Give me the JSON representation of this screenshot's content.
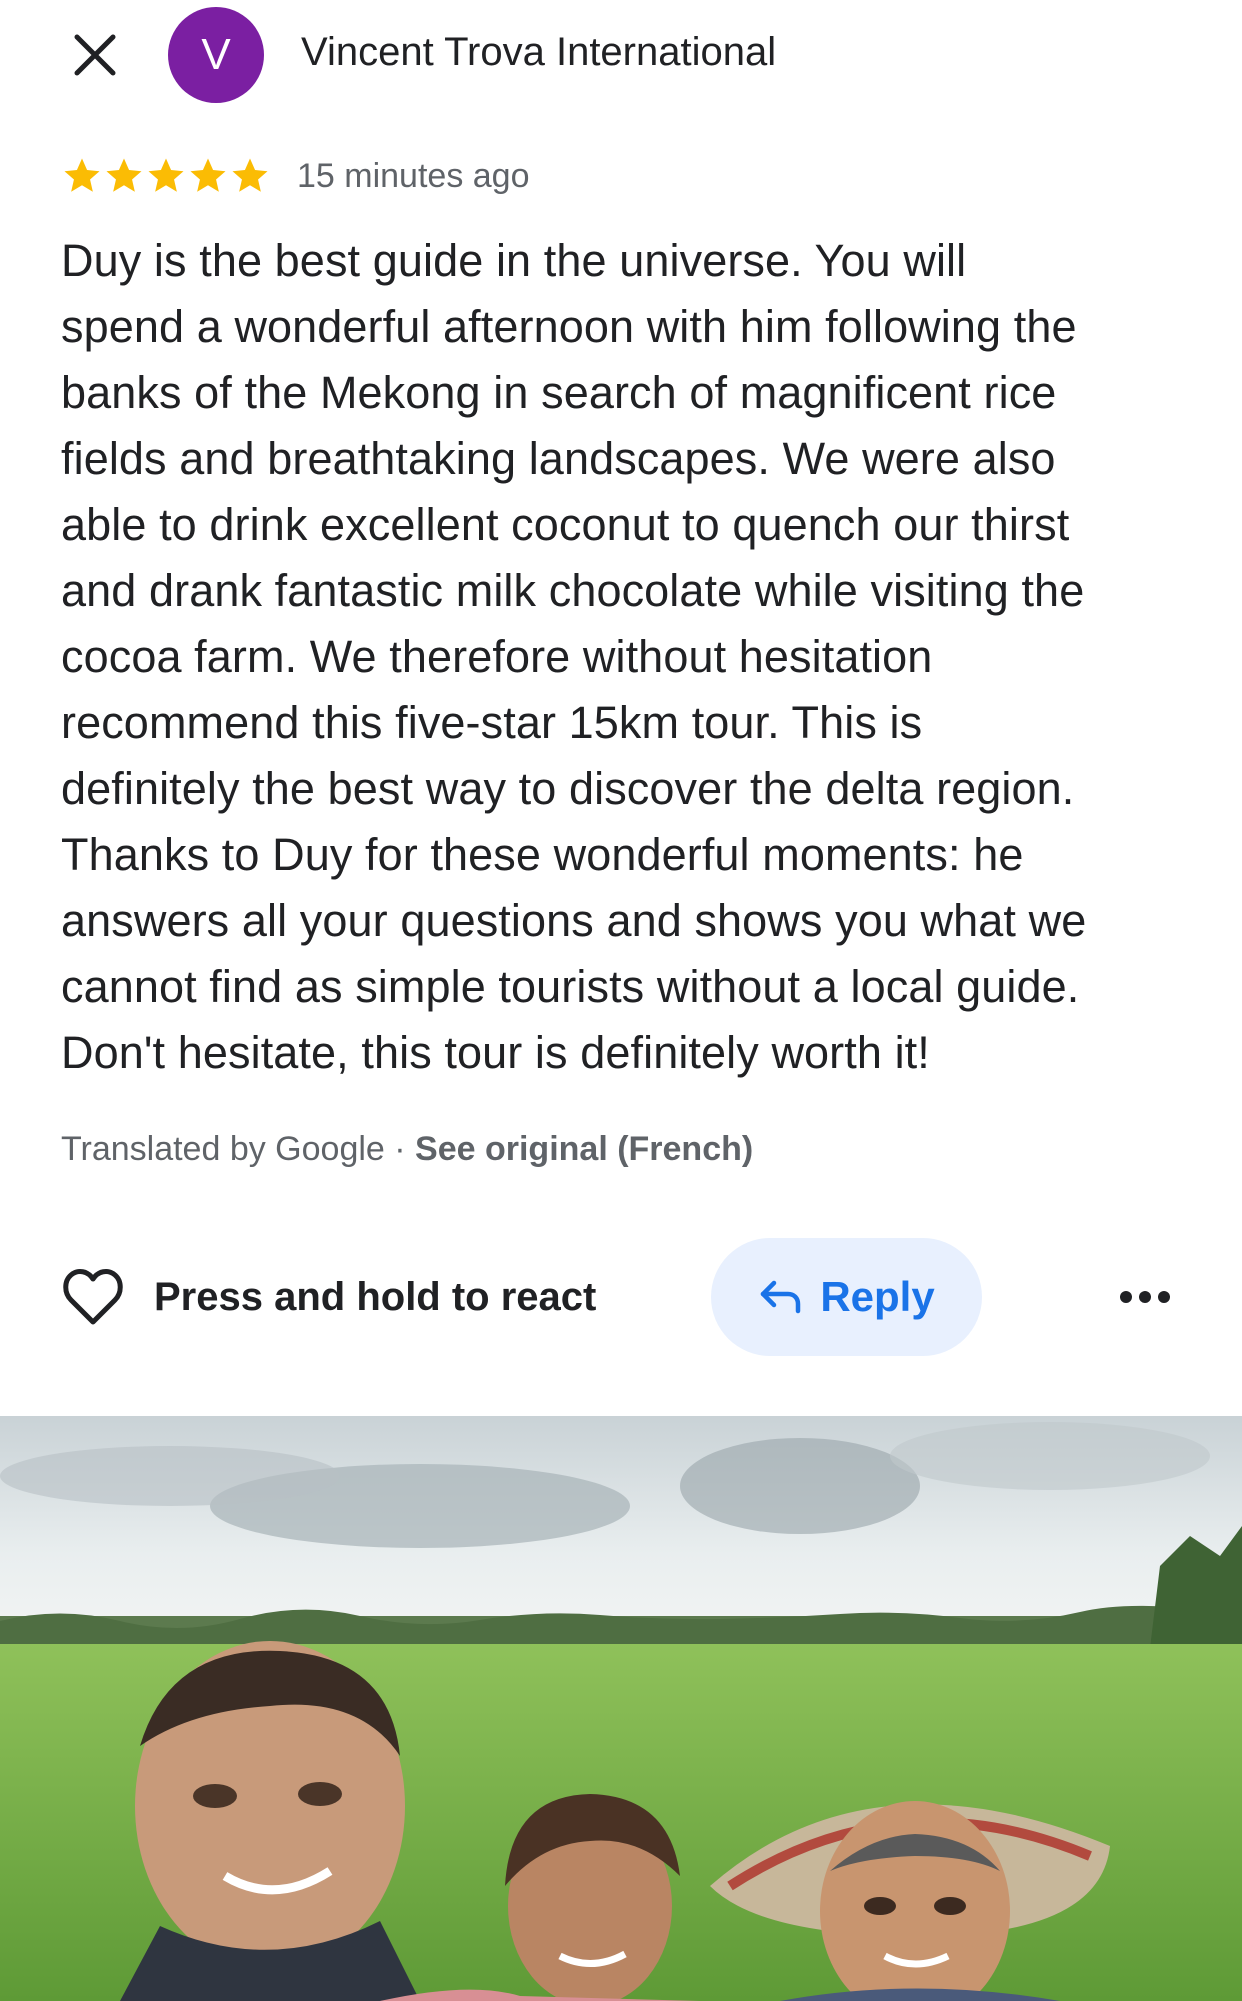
{
  "header": {
    "close_icon": "close-icon",
    "avatar_letter": "V",
    "avatar_color": "#7b1fa2",
    "author_name": "Vincent Trova International"
  },
  "review": {
    "rating": 5,
    "rating_max": 5,
    "star_color": "#fbbc04",
    "time_ago": "15 minutes ago",
    "lines": [
      "Duy is the best guide in the universe. You will",
      "spend a wonderful afternoon with him following the",
      "banks of the Mekong in search of magnificent rice",
      "fields and breathtaking landscapes. We were also",
      "able to drink excellent coconut to quench our thirst",
      "and drank fantastic milk chocolate while visiting the",
      "cocoa farm. We therefore without hesitation",
      "recommend this five-star 15km tour. This is",
      "definitely the best way to discover the delta region.",
      "Thanks to Duy for these wonderful moments: he",
      "answers all your questions and shows you what we",
      "cannot find as simple tourists without a local guide.",
      "Don't hesitate, this tour is definitely worth it!"
    ],
    "translated_by": "Translated by Google · ",
    "see_original": "See original (French)"
  },
  "actions": {
    "react_icon": "heart-outline-icon",
    "react_label": "Press and hold to react",
    "reply_icon": "reply-arrow-icon",
    "reply_label": "Reply",
    "reply_color": "#1a73e8",
    "reply_bg": "#e8f0fe",
    "more_icon": "more-horizontal-icon"
  },
  "photo": {
    "subject": "review-photo"
  }
}
